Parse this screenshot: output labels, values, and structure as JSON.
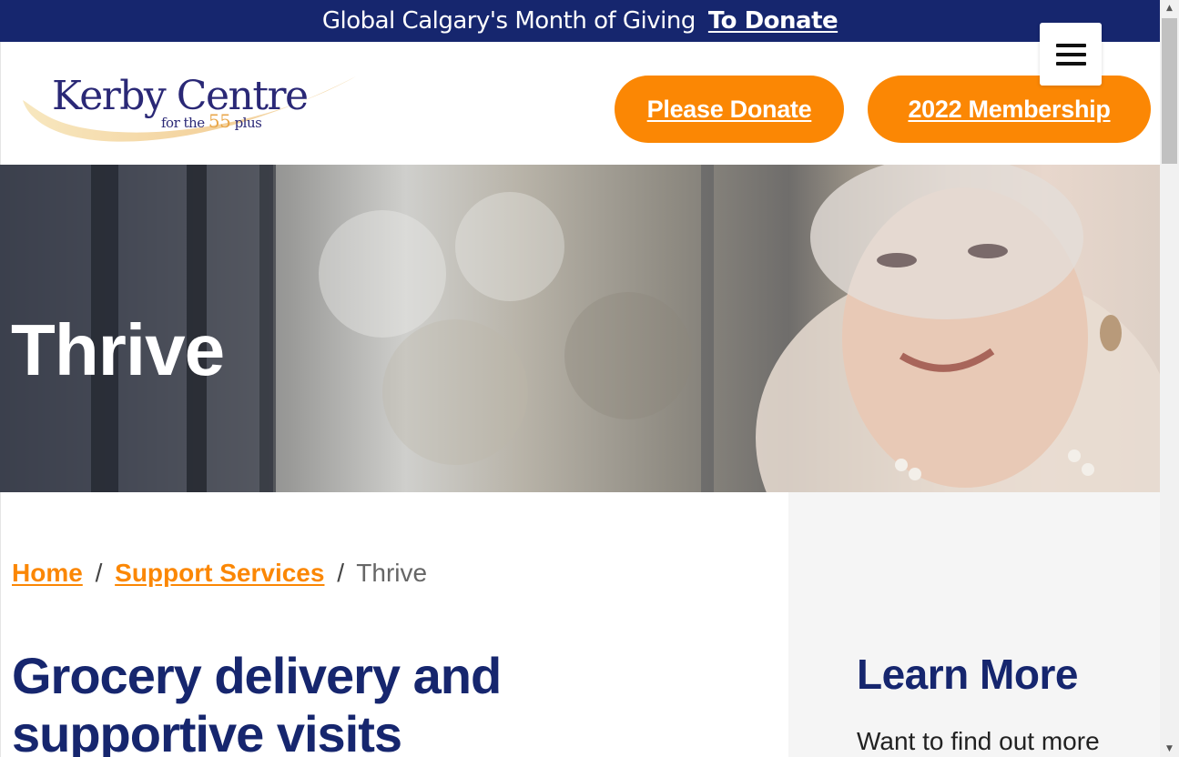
{
  "topbar": {
    "text": "Global Calgary's Month of Giving",
    "link": "To Donate"
  },
  "logo": {
    "name": "Kerby Centre",
    "tagline_before": "for the ",
    "tagline_number": "55",
    "tagline_after": " plus"
  },
  "header": {
    "donate_label": "Please Donate",
    "membership_label": "2022 Membership"
  },
  "hero": {
    "title": "Thrive"
  },
  "breadcrumb": {
    "home": "Home",
    "sep1": "/",
    "support": "Support Services",
    "sep2": "/",
    "current": "Thrive"
  },
  "main": {
    "headline": "Grocery delivery and supportive visits"
  },
  "aside": {
    "title": "Learn More",
    "text": "Want to find out more"
  },
  "colors": {
    "navy": "#16266e",
    "orange": "#fb8704"
  }
}
